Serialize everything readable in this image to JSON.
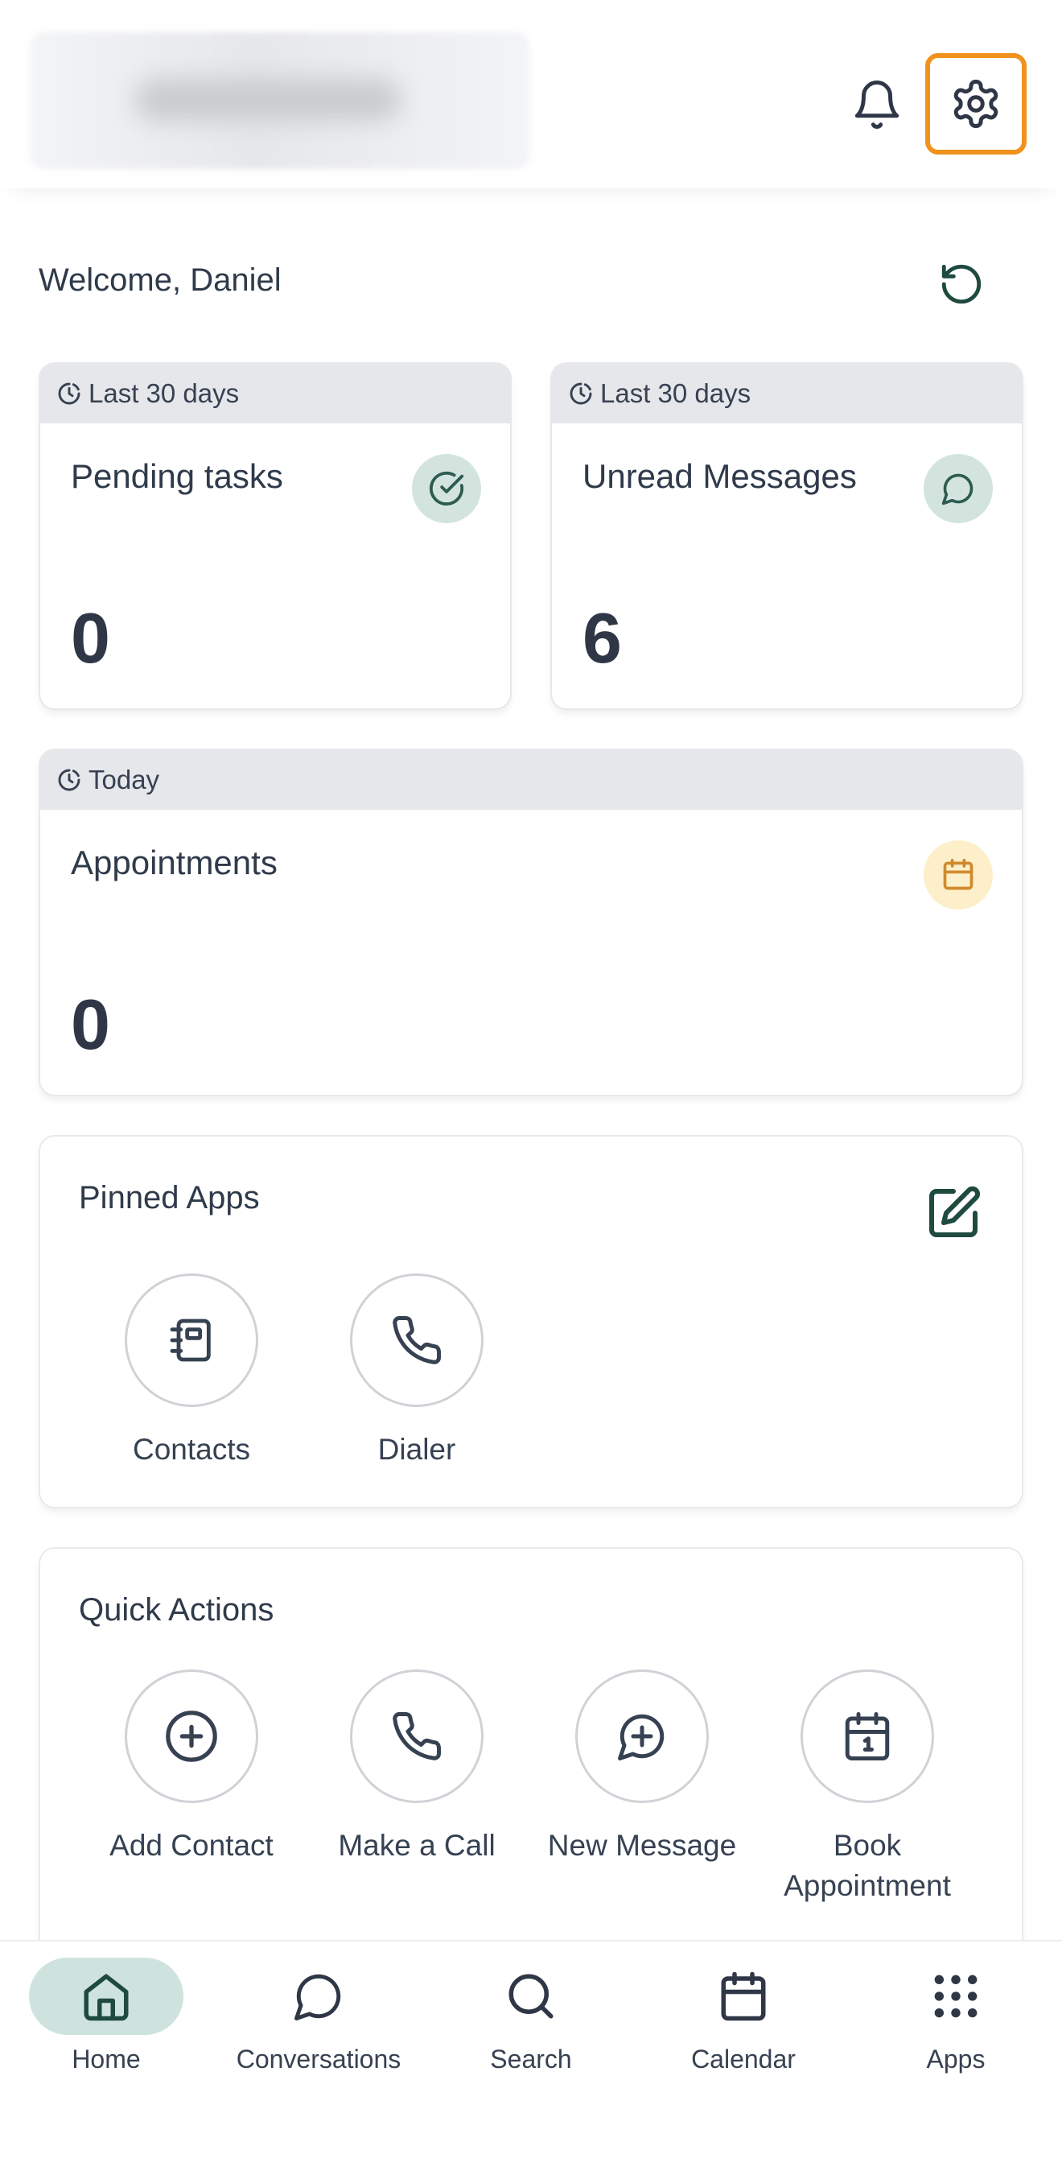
{
  "header": {
    "logo_blurred": true
  },
  "welcome": {
    "text": "Welcome, Daniel"
  },
  "stats": [
    {
      "period": "Last 30 days",
      "title": "Pending tasks",
      "value": "0",
      "icon": "check-circle-icon",
      "badge_color": "#d3e4df",
      "icon_color": "#2d5b4f"
    },
    {
      "period": "Last 30 days",
      "title": "Unread Messages",
      "value": "6",
      "icon": "message-circle-icon",
      "badge_color": "#d3e4df",
      "icon_color": "#2d5b4f"
    },
    {
      "period": "Today",
      "title": "Appointments",
      "value": "0",
      "icon": "calendar-icon",
      "badge_color": "#fcefc9",
      "icon_color": "#d08a2c"
    }
  ],
  "pinned_apps": {
    "title": "Pinned Apps",
    "apps": [
      {
        "label": "Contacts",
        "icon": "contacts-book-icon"
      },
      {
        "label": "Dialer",
        "icon": "phone-icon"
      }
    ]
  },
  "quick_actions": {
    "title": "Quick Actions",
    "actions": [
      {
        "label": "Add Contact",
        "icon": "plus-circle-icon"
      },
      {
        "label": "Make a Call",
        "icon": "phone-icon"
      },
      {
        "label": "New Message",
        "icon": "message-plus-icon"
      },
      {
        "label_line1": "Book",
        "label_line2": "Appointment",
        "icon": "calendar-day-icon"
      }
    ]
  },
  "bottom_nav": [
    {
      "label": "Home",
      "icon": "home-icon",
      "active": true
    },
    {
      "label": "Conversations",
      "icon": "chat-icon",
      "active": false
    },
    {
      "label": "Search",
      "icon": "search-icon",
      "active": false
    },
    {
      "label": "Calendar",
      "icon": "calendar-icon",
      "active": false
    },
    {
      "label": "Apps",
      "icon": "grid-dots-icon",
      "active": false
    }
  ],
  "colors": {
    "accent_highlight": "#f0921d",
    "brand_green": "#1f4a3f",
    "active_nav_bg": "#cfe3de"
  }
}
